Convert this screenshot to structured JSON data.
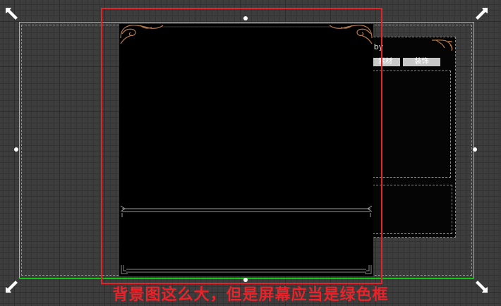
{
  "editor": {
    "colors": {
      "grid_background": "#3d3d3d",
      "screen_frame": "#3dff3d",
      "background_frame": "#e3242b",
      "panel_fill": "#000000",
      "ornament": "#b87a4b"
    }
  },
  "side_panel": {
    "title": "aby",
    "tabs": [
      {
        "label": "素材"
      },
      {
        "label": "装饰"
      }
    ]
  },
  "main_panel": {
    "corner_icon": "ornate-corner-icon"
  },
  "annotation": {
    "caption": "背景图这么大，但是屏幕应当是绿色框"
  }
}
